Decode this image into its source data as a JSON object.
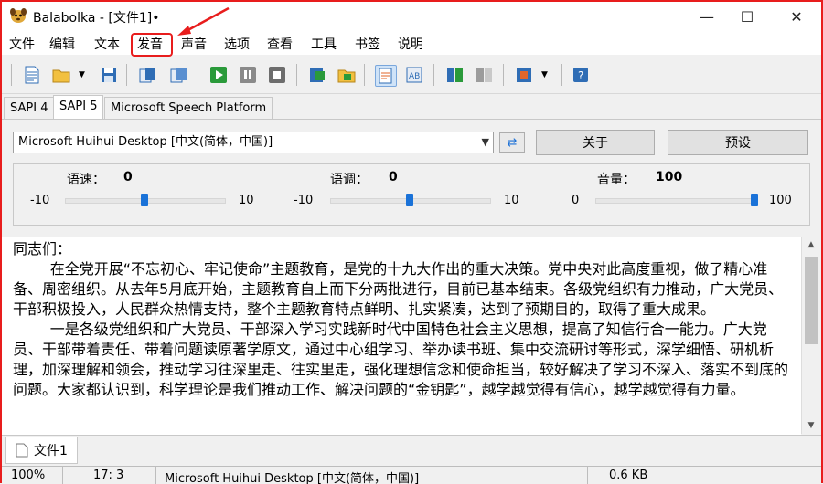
{
  "app": {
    "title": "Balabolka - [文件1]•"
  },
  "window_controls": {
    "minimize": "—",
    "maximize": "☐",
    "close": "✕"
  },
  "menu": [
    "文件",
    "编辑",
    "文本",
    "发音",
    "声音",
    "选项",
    "查看",
    "工具",
    "书签",
    "说明"
  ],
  "menu_highlighted_index": 3,
  "toolbar": {
    "buttons": [
      "new-file-icon",
      "open-folder-icon",
      "open-dropdown-icon",
      "save-icon",
      "read-clipboard-icon",
      "read-selection-icon",
      "play-icon",
      "pause-icon",
      "stop-icon",
      "save-audio-icon",
      "open-audio-icon",
      "spell-check-icon",
      "text-preview-icon",
      "split-file-icon",
      "convert-file-icon",
      "voice-settings-icon",
      "voice-dropdown-icon",
      "help-icon"
    ]
  },
  "tabs": [
    "SAPI 4",
    "SAPI 5",
    "Microsoft Speech Platform"
  ],
  "active_tab": 1,
  "voice": {
    "selected": "Microsoft Huihui Desktop [中文(简体，中国)]",
    "about_label": "关于",
    "preset_label": "预设"
  },
  "sliders": {
    "rate": {
      "label": "语速：",
      "value": "0",
      "min": "-10",
      "max": "10",
      "level_fraction": 0.5
    },
    "pitch": {
      "label": "语调：",
      "value": "0",
      "min": "-10",
      "max": "10",
      "level_fraction": 0.5
    },
    "volume": {
      "label": "音量：",
      "value": "100",
      "min": "0",
      "max": "100",
      "level_fraction": 1.0
    }
  },
  "editor": {
    "text": "同志们：\n        在全党开展“不忘初心、牢记使命”主题教育，是党的十九大作出的重大决策。党中央对此高度重视，做了精心准备、周密组织。从去年5月底开始，主题教育自上而下分两批进行，目前已基本结束。各级党组织有力推动，广大党员、干部积极投入，人民群众热情支持，整个主题教育特点鲜明、扎实紧凑，达到了预期目的，取得了重大成果。\n        一是各级党组织和广大党员、干部深入学习实践新时代中国特色社会主义思想，提高了知信行合一能力。广大党员、干部带着责任、带着问题读原著学原文，通过中心组学习、举办读书班、集中交流研讨等形式，深学细悟、研机析理，加深理解和领会，推动学习往深里走、往实里走，强化理想信念和使命担当，较好解决了学习不深入、落实不到底的问题。大家都认识到，科学理论是我们推动工作、解决问题的“金钥匙”，越学越觉得有信心，越学越觉得有力量。"
  },
  "doc_tabs": [
    "文件1"
  ],
  "status": {
    "zoom": "100%",
    "position": "17:   3",
    "voice": "Microsoft Huihui Desktop [中文(简体，中国)]",
    "size": "0.6 KB"
  }
}
